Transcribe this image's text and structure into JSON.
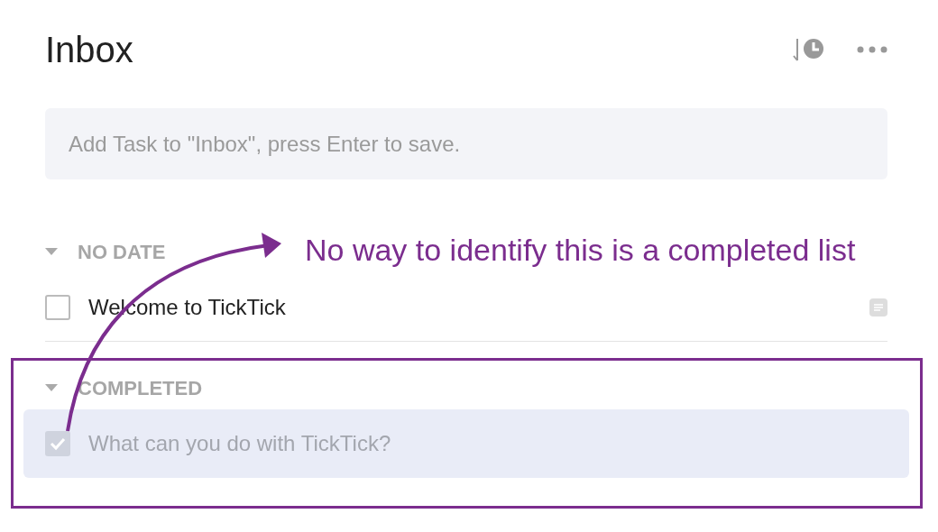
{
  "title": "Inbox",
  "add_task": {
    "placeholder": "Add Task to \"Inbox\", press Enter to save."
  },
  "sections": [
    {
      "label": "NO DATE",
      "expanded": true,
      "tasks": [
        {
          "title": "Welcome to TickTick",
          "checked": false,
          "selected": false,
          "has_note": true
        }
      ]
    },
    {
      "label": "COMPLETED",
      "expanded": true,
      "tasks": [
        {
          "title": "What can you do with TickTick?",
          "checked": true,
          "selected": true,
          "has_note": false
        }
      ]
    }
  ],
  "annotation": {
    "text": "No way to identify this is a completed list"
  }
}
